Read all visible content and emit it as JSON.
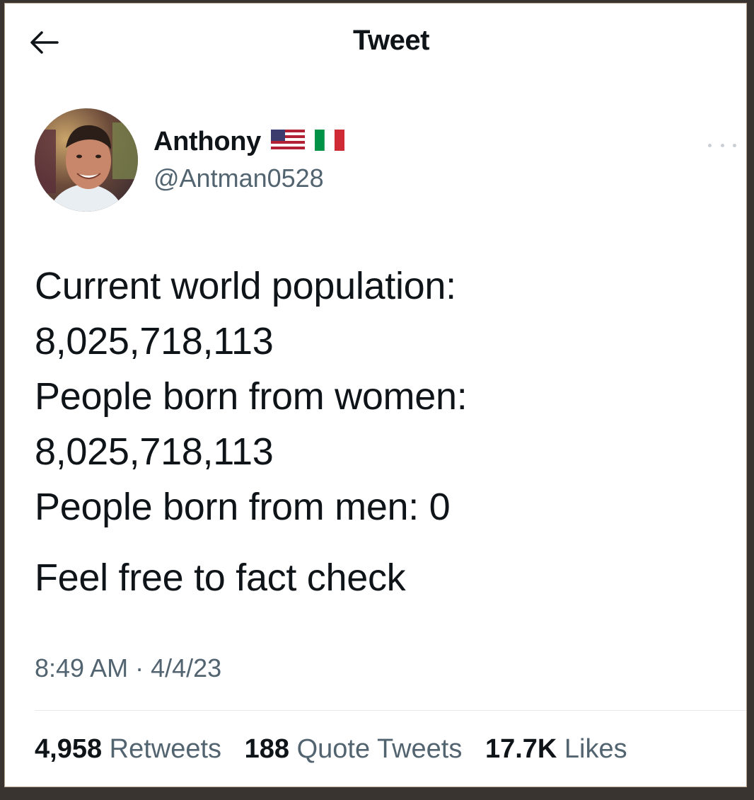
{
  "header": {
    "title": "Tweet"
  },
  "author": {
    "display_name": "Anthony",
    "handle": "@Antman0528",
    "flags": [
      "us-flag-icon",
      "italy-flag-icon"
    ]
  },
  "tweet": {
    "lines": [
      "Current world population:",
      "8,025,718,113",
      "People born from women:",
      "8,025,718,113",
      "People born from men: 0"
    ],
    "closing": "Feel free to fact check",
    "timestamp": "8:49 AM · 4/4/23"
  },
  "stats": {
    "retweets_count": "4,958",
    "retweets_label": "Retweets",
    "quotes_count": "188",
    "quotes_label": "Quote Tweets",
    "likes_count": "17.7K",
    "likes_label": "Likes"
  },
  "colors": {
    "text_primary": "#0f1419",
    "text_secondary": "#536471",
    "divider": "#e6e9eb"
  }
}
